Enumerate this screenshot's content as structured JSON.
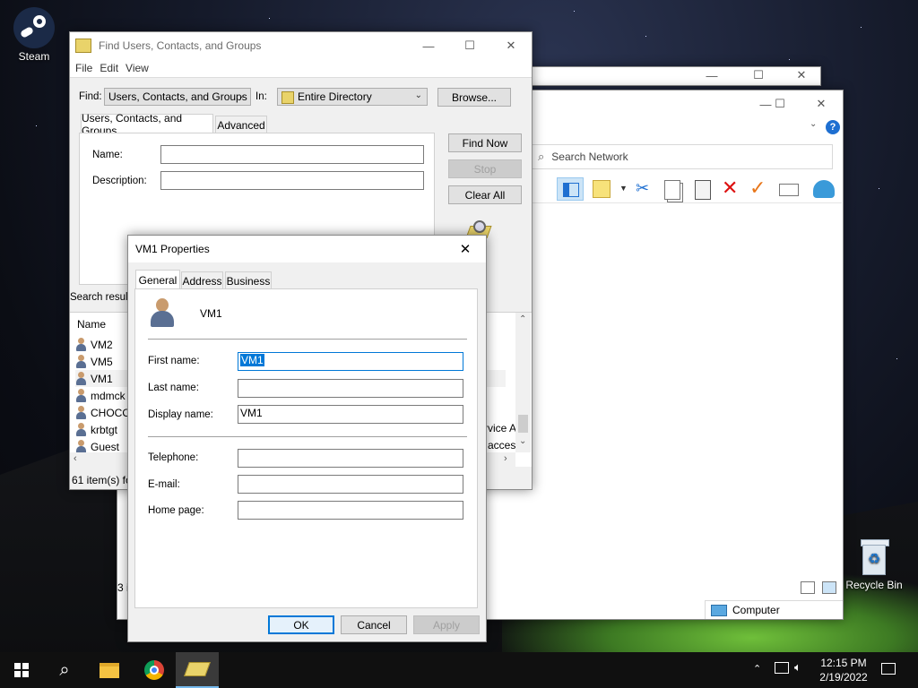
{
  "desktop": {
    "steam_label": "Steam",
    "recycle_label": "Recycle Bin"
  },
  "explorer": {
    "search_placeholder": "Search Network",
    "status_left": "3 i",
    "status_computer": "Computer"
  },
  "find": {
    "title": "Find Users, Contacts, and Groups",
    "menu": [
      "File",
      "Edit",
      "View"
    ],
    "find_label": "Find:",
    "find_value": "Users, Contacts, and Groups",
    "in_label": "In:",
    "in_value": "Entire Directory",
    "browse": "Browse...",
    "tabs": [
      "Users, Contacts, and Groups",
      "Advanced"
    ],
    "name_label": "Name:",
    "desc_label": "Description:",
    "find_now": "Find Now",
    "stop": "Stop",
    "clear_all": "Clear All",
    "results_label": "Search results",
    "col_name": "Name",
    "rows": [
      "VM2",
      "VM5",
      "VM1",
      "mdmck",
      "CHOCO",
      "krbtgt",
      "Guest"
    ],
    "right_col_rows": [
      "rvice A",
      "acces"
    ],
    "status": "61 item(s) fo"
  },
  "props": {
    "title": "VM1 Properties",
    "tabs": [
      "General",
      "Address",
      "Business"
    ],
    "header_name": "VM1",
    "first_name_label": "First name:",
    "first_name_value": "VM1",
    "last_name_label": "Last name:",
    "last_name_value": "",
    "display_name_label": "Display name:",
    "display_name_value": "VM1",
    "telephone_label": "Telephone:",
    "email_label": "E-mail:",
    "homepage_label": "Home page:",
    "ok": "OK",
    "cancel": "Cancel",
    "apply": "Apply"
  },
  "taskbar": {
    "time": "12:15 PM",
    "date": "2/19/2022"
  }
}
